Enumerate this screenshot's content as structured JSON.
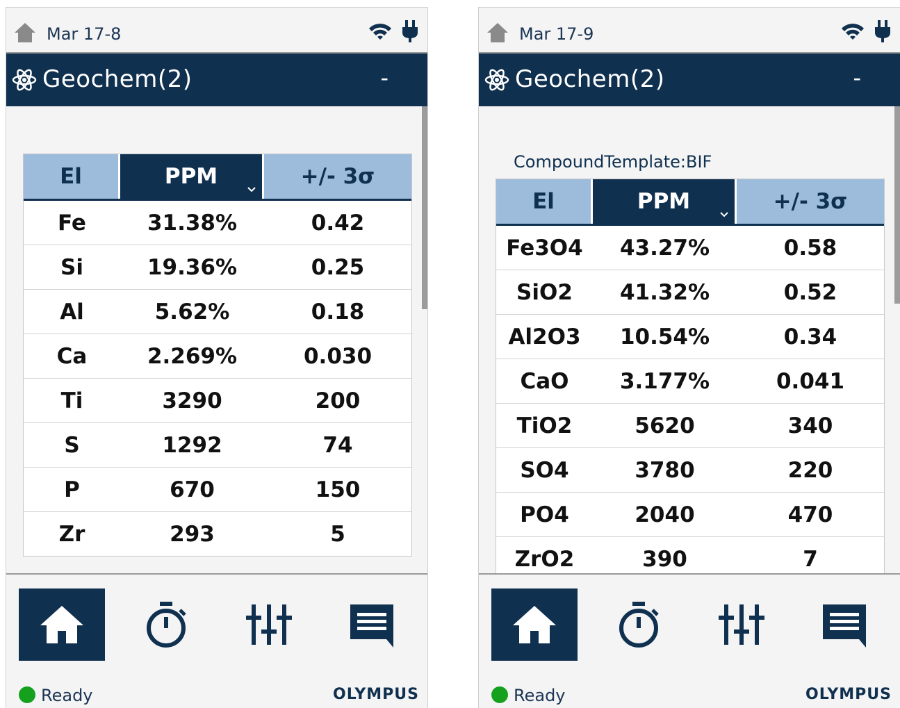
{
  "colors": {
    "navy": "#10304f",
    "header_blue": "#9dbcdb",
    "ready_green": "#15a11e"
  },
  "icons": {
    "home": "home-icon",
    "wifi": "wifi-icon",
    "power": "plug-icon",
    "atom": "atom-icon",
    "sort": "chevron-down-icon",
    "timer": "stopwatch-icon",
    "settings": "sliders-icon",
    "messages": "message-icon"
  },
  "screens": [
    {
      "timestamp": "Mar 17-8",
      "title": "Geochem(2)",
      "minimize_label": "-",
      "template_label": "",
      "columns": [
        "El",
        "PPM",
        "+/- 3σ"
      ],
      "rows": [
        {
          "el": "Fe",
          "value": "31.38%",
          "err": "0.42"
        },
        {
          "el": "Si",
          "value": "19.36%",
          "err": "0.25"
        },
        {
          "el": "Al",
          "value": "5.62%",
          "err": "0.18"
        },
        {
          "el": "Ca",
          "value": "2.269%",
          "err": "0.030"
        },
        {
          "el": "Ti",
          "value": "3290",
          "err": "200"
        },
        {
          "el": "S",
          "value": "1292",
          "err": "74"
        },
        {
          "el": "P",
          "value": "670",
          "err": "150"
        },
        {
          "el": "Zr",
          "value": "293",
          "err": "5"
        }
      ],
      "status": "Ready",
      "brand": "OLYMPUS"
    },
    {
      "timestamp": "Mar 17-9",
      "title": "Geochem(2)",
      "minimize_label": "-",
      "template_label": "CompoundTemplate:BIF",
      "columns": [
        "El",
        "PPM",
        "+/- 3σ"
      ],
      "rows": [
        {
          "el": "Fe3O4",
          "value": "43.27%",
          "err": "0.58"
        },
        {
          "el": "SiO2",
          "value": "41.32%",
          "err": "0.52"
        },
        {
          "el": "Al2O3",
          "value": "10.54%",
          "err": "0.34"
        },
        {
          "el": "CaO",
          "value": "3.177%",
          "err": "0.041"
        },
        {
          "el": "TiO2",
          "value": "5620",
          "err": "340"
        },
        {
          "el": "SO4",
          "value": "3780",
          "err": "220"
        },
        {
          "el": "PO4",
          "value": "2040",
          "err": "470"
        },
        {
          "el": "ZrO2",
          "value": "390",
          "err": "7"
        }
      ],
      "status": "Ready",
      "brand": "OLYMPUS"
    }
  ]
}
